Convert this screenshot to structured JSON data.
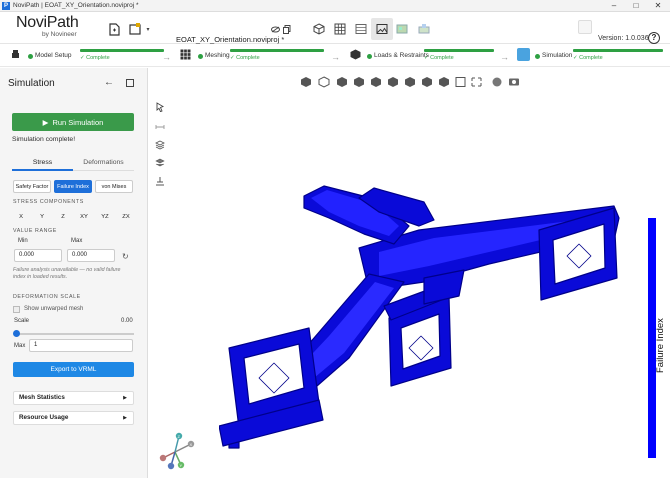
{
  "window": {
    "title": "NoviPath | EOAT_XY_Orientation.noviproj *",
    "app_icon": "P",
    "controls": {
      "minimize": "–",
      "maximize": "□",
      "close": "✕"
    }
  },
  "toolbar": {
    "logo_name": "NoviPath",
    "logo_sub": "by Novineer",
    "file_name": "EOAT_XY_Orientation.noviproj *",
    "version": "Version: 1.0.036",
    "help": "?"
  },
  "steps": [
    {
      "label": "Model Setup",
      "status": "✓ Complete",
      "progress": 1.0
    },
    {
      "label": "Meshing",
      "status": "✓ Complete",
      "progress": 1.0
    },
    {
      "label": "Loads & Restraints",
      "status": "✓ Complete",
      "progress": 1.0
    },
    {
      "label": "Simulation",
      "status": "✓ Complete",
      "progress": 1.0
    }
  ],
  "sidebar": {
    "title": "Simulation",
    "back": "←",
    "run_label": "Run Simulation",
    "run_status": "Simulation complete!",
    "tabs": [
      "Stress",
      "Deformations"
    ],
    "result_types": [
      "Safety Factor",
      "Failure Index",
      "von Mises"
    ],
    "active_result": "Failure Index",
    "stress_components_label": "STRESS COMPONENTS",
    "components": [
      "X",
      "Y",
      "Z",
      "XY",
      "YZ",
      "ZX"
    ],
    "value_range_label": "VALUE RANGE",
    "min_label": "Min",
    "max_label": "Max",
    "min_value": "0.000",
    "max_value": "0.000",
    "reset_icon": "↻",
    "note": "Failure analysis unavailable — no valid failure index in loaded results.",
    "deformation_scale_label": "DEFORMATION SCALE",
    "show_unwarped_label": "Show unwarped mesh",
    "scale_label": "Scale",
    "scale_value": "0.00",
    "max_field_label": "Max",
    "max_field_value": "1",
    "export_label": "Export to VRML",
    "mesh_statistics": "Mesh Statistics",
    "resource_usage": "Resource Usage",
    "chevron": "▶"
  },
  "viewport": {
    "legend_label": "Failure Index",
    "legend_color": "#0000ff",
    "model_color": "#0a0ad8",
    "axis": {
      "x": "X",
      "y": "Y",
      "z": "Z"
    }
  }
}
